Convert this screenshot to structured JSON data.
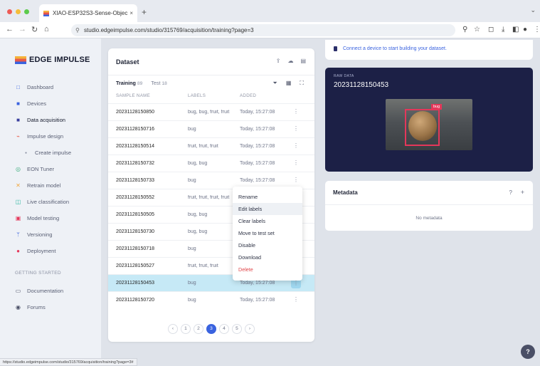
{
  "browser": {
    "tab_title": "XIAO-ESP32S3-Sense-Objec",
    "tab_close": "×",
    "new_tab": "+",
    "tab_menu": "⌄",
    "url": "studio.edgeimpulse.com/studio/315769/acquisition/training?page=3",
    "status_url": "https://studio.edgeimpulse.com/studio/315769/acquisition/training?page=3#"
  },
  "sidebar": {
    "logo_text": "EDGE IMPULSE",
    "items": [
      {
        "label": "Dashboard",
        "icon": "□"
      },
      {
        "label": "Devices",
        "icon": "■"
      },
      {
        "label": "Data acquisition",
        "icon": "■"
      },
      {
        "label": "Impulse design",
        "icon": "⌁"
      },
      {
        "label": "Create impulse",
        "icon": "●"
      },
      {
        "label": "EON Tuner",
        "icon": "◎"
      },
      {
        "label": "Retrain model",
        "icon": "✕"
      },
      {
        "label": "Live classification",
        "icon": "◫"
      },
      {
        "label": "Model testing",
        "icon": "▣"
      },
      {
        "label": "Versioning",
        "icon": "ᛘ"
      },
      {
        "label": "Deployment",
        "icon": "●"
      }
    ],
    "section_title": "GETTING STARTED",
    "footer_items": [
      {
        "label": "Documentation",
        "icon": "▭"
      },
      {
        "label": "Forums",
        "icon": "◉"
      }
    ]
  },
  "dataset": {
    "title": "Dataset",
    "tabs": [
      {
        "label": "Training",
        "count": "89",
        "active": true
      },
      {
        "label": "Test",
        "count": "18",
        "active": false
      }
    ],
    "columns": [
      "SAMPLE NAME",
      "LABELS",
      "ADDED"
    ],
    "rows": [
      {
        "name": "20231128150850",
        "labels": "bug, bug, fruit, fruit",
        "added": "Today, 15:27:08"
      },
      {
        "name": "20231128150716",
        "labels": "bug",
        "added": "Today, 15:27:08"
      },
      {
        "name": "20231128150514",
        "labels": "fruit, fruit, fruit",
        "added": "Today, 15:27:08"
      },
      {
        "name": "20231128150732",
        "labels": "bug, bug",
        "added": "Today, 15:27:08"
      },
      {
        "name": "20231128150733",
        "labels": "bug",
        "added": "Today, 15:27:08"
      },
      {
        "name": "20231128150552",
        "labels": "fruit, fruit, fruit, fruit",
        "added": ""
      },
      {
        "name": "20231128150505",
        "labels": "bug, bug",
        "added": ""
      },
      {
        "name": "20231128150730",
        "labels": "bug, bug",
        "added": ""
      },
      {
        "name": "20231128150718",
        "labels": "bug",
        "added": ""
      },
      {
        "name": "20231128150527",
        "labels": "fruit, fruit, fruit",
        "added": ""
      },
      {
        "name": "20231128150453",
        "labels": "bug",
        "added": "Today, 15:27:08",
        "selected": true
      },
      {
        "name": "20231128150720",
        "labels": "bug",
        "added": "Today, 15:27:08"
      }
    ],
    "row_menu": "⋮",
    "pagination": [
      "‹",
      "1",
      "2",
      "3",
      "4",
      "5",
      "›"
    ],
    "current_page": "3"
  },
  "context_menu": [
    "Rename",
    "Edit labels",
    "Clear labels",
    "Move to test set",
    "Disable",
    "Download",
    "Delete"
  ],
  "connect": {
    "text": "Connect a device to start building your dataset."
  },
  "raw_data": {
    "label": "RAW DATA",
    "name": "20231128150453",
    "box_label": "bug"
  },
  "metadata": {
    "title": "Metadata",
    "help": "?",
    "add": "+",
    "empty": "No metadata"
  },
  "help_button": "?",
  "colors": {
    "accent": "#3a63df",
    "danger": "#e0464a",
    "selected_row": "#c6e9f6",
    "raw_bg": "#1c2046"
  }
}
